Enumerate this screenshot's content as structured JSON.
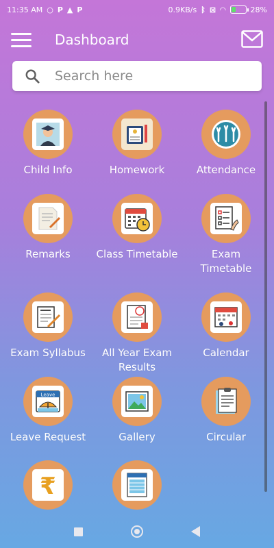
{
  "status_bar": {
    "time": "11:35 AM",
    "left_icons": [
      "p-icon",
      "p-icon",
      "warning-icon",
      "p-icon"
    ],
    "speed": "0.9KB/s",
    "battery": "28%"
  },
  "app_bar": {
    "title": "Dashboard"
  },
  "search": {
    "placeholder": "Search here"
  },
  "tiles": [
    {
      "label": "Child Info",
      "icon": "child-info-icon"
    },
    {
      "label": "Homework",
      "icon": "homework-icon"
    },
    {
      "label": "Attendance",
      "icon": "attendance-icon"
    },
    {
      "label": "Remarks",
      "icon": "remarks-icon"
    },
    {
      "label": "Class Timetable",
      "icon": "class-timetable-icon"
    },
    {
      "label": "Exam\nTimetable",
      "icon": "exam-timetable-icon"
    },
    {
      "label": "Exam Syllabus",
      "icon": "exam-syllabus-icon"
    },
    {
      "label": "All Year Exam\nResults",
      "icon": "exam-results-icon"
    },
    {
      "label": "Calendar",
      "icon": "calendar-icon"
    },
    {
      "label": "Leave Request",
      "icon": "leave-request-icon"
    },
    {
      "label": "Gallery",
      "icon": "gallery-icon"
    },
    {
      "label": "Circular",
      "icon": "circular-icon"
    },
    {
      "label": "",
      "icon": "rupee-icon"
    },
    {
      "label": "",
      "icon": "receipt-icon"
    }
  ],
  "icon_texts": {
    "leave": "Leave"
  },
  "colors": {
    "tile_circle": "#e59b5e",
    "gradient_top": "#c476d8",
    "gradient_bottom": "#67a8e3"
  }
}
